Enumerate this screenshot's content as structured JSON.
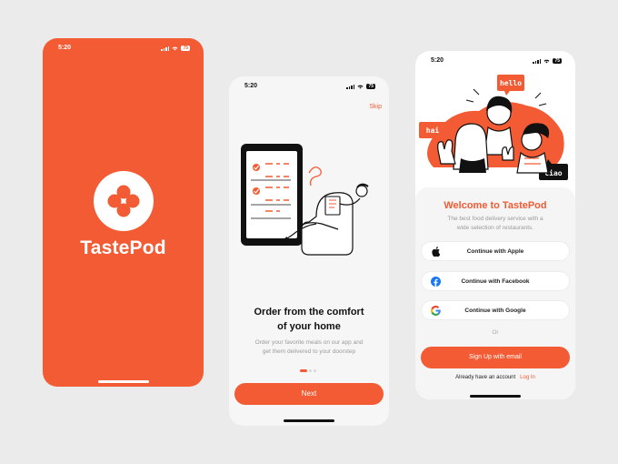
{
  "colors": {
    "accent": "#f25b33",
    "background": "#ebebeb"
  },
  "splash": {
    "time": "5:20",
    "battery": "75",
    "logo_icon": "four-petal-clover-icon",
    "brand": "TastePod"
  },
  "onboarding": {
    "time": "5:20",
    "battery": "75",
    "skip_label": "Skip",
    "title_line1": "Order from the comfort",
    "title_line2": "of your home",
    "desc_line1": "Order your favorite meals on our app and",
    "desc_line2": "get them delivered to your doorstep",
    "page_count": 3,
    "current_page": 1,
    "next_label": "Next"
  },
  "welcome": {
    "time": "5:20",
    "battery": "75",
    "bubbles": [
      "hello",
      "hai",
      "ciao"
    ],
    "title": "Welcome to TastePod",
    "desc_line1": "The best food delivery service with a",
    "desc_line2": "wide selection of restaurants.",
    "buttons": [
      {
        "label": "Continue with Apple",
        "icon": "apple-icon"
      },
      {
        "label": "Continue with Facebook",
        "icon": "facebook-icon"
      },
      {
        "label": "Continue with Google",
        "icon": "google-icon"
      }
    ],
    "or_label": "Or",
    "signup_label": "Sign Up with email",
    "have_account": "Already have an account",
    "login_label": "Log In"
  }
}
